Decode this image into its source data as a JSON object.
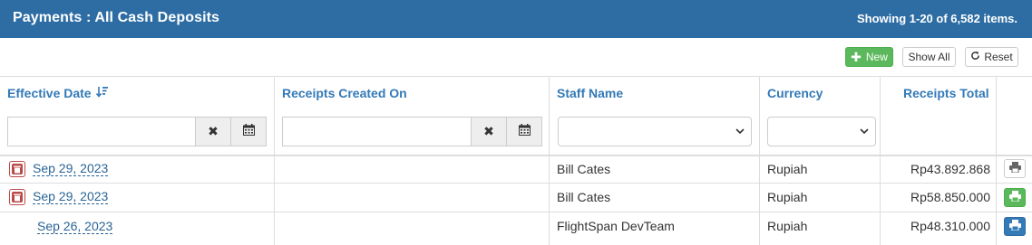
{
  "header": {
    "title": "Payments : All Cash Deposits",
    "count_text": "Showing 1-20 of 6,582 items."
  },
  "toolbar": {
    "new_label": "New",
    "show_all_label": "Show All",
    "reset_label": "Reset"
  },
  "table": {
    "columns": [
      {
        "label": "Effective Date",
        "sort_icon": "sort-desc-icon"
      },
      {
        "label": "Receipts Created On"
      },
      {
        "label": "Staff Name"
      },
      {
        "label": "Currency"
      },
      {
        "label": "Receipts Total"
      }
    ],
    "filters": {
      "effective_date": "",
      "receipts_created_on": "",
      "staff_name": "",
      "currency": ""
    },
    "rows": [
      {
        "effective_date": "Sep 29, 2023",
        "receipts_created_on": "",
        "staff_name": "Bill Cates",
        "currency": "Rupiah",
        "receipts_total": "Rp43.892.868",
        "has_delete": true,
        "print_style": "default"
      },
      {
        "effective_date": "Sep 29, 2023",
        "receipts_created_on": "",
        "staff_name": "Bill Cates",
        "currency": "Rupiah",
        "receipts_total": "Rp58.850.000",
        "has_delete": true,
        "print_style": "success"
      },
      {
        "effective_date": "Sep 26, 2023",
        "receipts_created_on": "",
        "staff_name": "FlightSpan DevTeam",
        "currency": "Rupiah",
        "receipts_total": "Rp48.310.000",
        "has_delete": false,
        "print_style": "primary"
      }
    ]
  },
  "colors": {
    "header_bg": "#2e6da4",
    "link": "#337ab7",
    "success": "#5cb85c",
    "danger": "#b94a48",
    "primary": "#337ab7"
  }
}
